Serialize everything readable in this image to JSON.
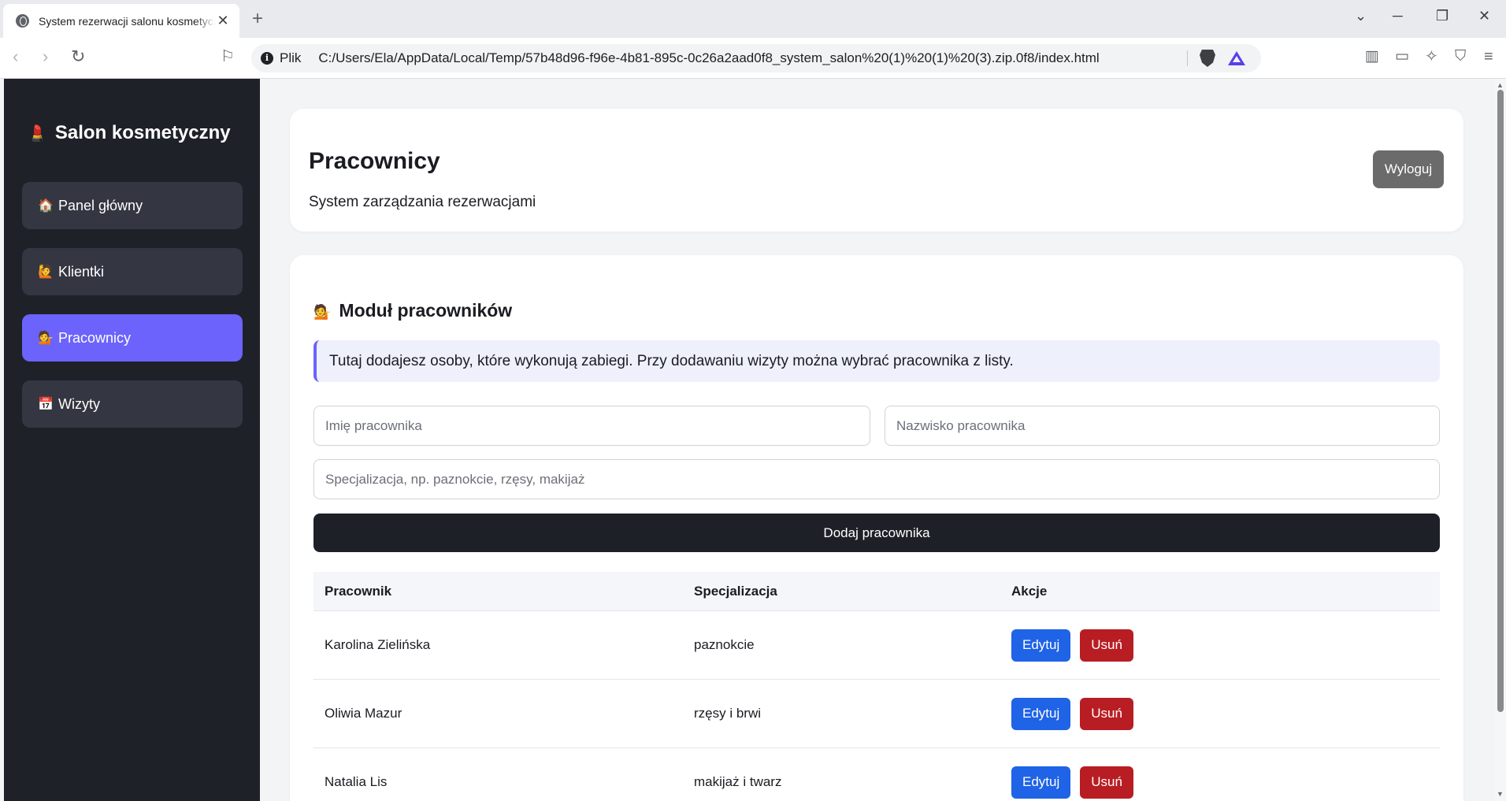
{
  "browser": {
    "tab_title": "System rezerwacji salonu kosmetycznego",
    "scheme_label": "Plik",
    "url": "C:/Users/Ela/AppData/Local/Temp/57b48d96-f96e-4b81-895c-0c26a2aad0f8_system_salon%20(1)%20(1)%20(3).zip.0f8/index.html"
  },
  "sidebar": {
    "logo_emoji": "💄",
    "logo_text": "Salon kosmetyczny",
    "items": [
      {
        "icon": "🏠",
        "label": "Panel główny",
        "active": false
      },
      {
        "icon": "🙋",
        "label": "Klientki",
        "active": false
      },
      {
        "icon": "💁",
        "label": "Pracownicy",
        "active": true
      },
      {
        "icon": "📅",
        "label": "Wizyty",
        "active": false
      }
    ]
  },
  "header": {
    "title": "Pracownicy",
    "subtitle": "System zarządzania rezerwacjami",
    "logout_label": "Wyloguj"
  },
  "module": {
    "emoji": "💁",
    "title": "Moduł pracowników",
    "info": "Tutaj dodajesz osoby, które wykonują zabiegi. Przy dodawaniu wizyty można wybrać pracownika z listy.",
    "first_name_placeholder": "Imię pracownika",
    "last_name_placeholder": "Nazwisko pracownika",
    "specialization_placeholder": "Specjalizacja, np. paznokcie, rzęsy, makijaż",
    "add_button": "Dodaj pracownika"
  },
  "table": {
    "headers": [
      "Pracownik",
      "Specjalizacja",
      "Akcje"
    ],
    "edit_label": "Edytuj",
    "delete_label": "Usuń",
    "rows": [
      {
        "name": "Karolina Zielińska",
        "specialization": "paznokcie"
      },
      {
        "name": "Oliwia Mazur",
        "specialization": "rzęsy i brwi"
      },
      {
        "name": "Natalia Lis",
        "specialization": "makijaż i twarz"
      }
    ]
  },
  "colors": {
    "accent": "#6b63fb",
    "sidebar_bg": "#1f2129",
    "edit": "#1f63e6",
    "delete": "#b81d23"
  }
}
